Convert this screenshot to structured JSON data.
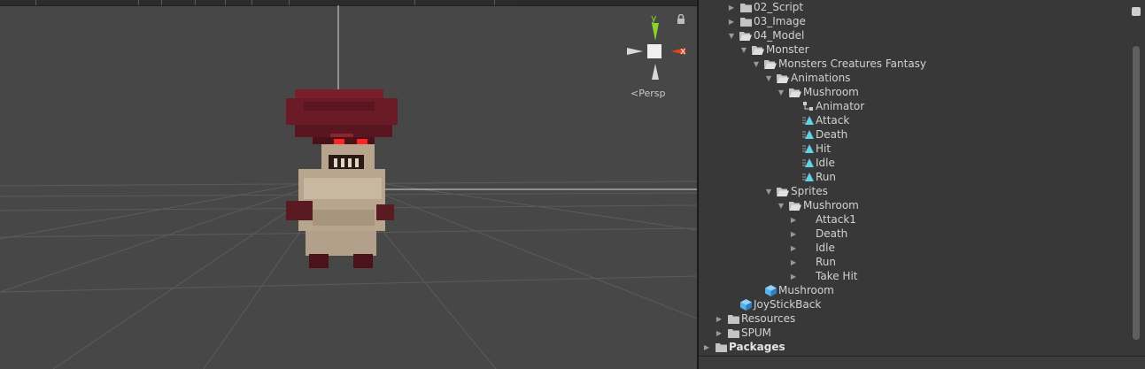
{
  "scene": {
    "persp_label": "Persp",
    "axis_y": "y",
    "axis_x": "x"
  },
  "tree": {
    "items": [
      {
        "label": "02_Script",
        "icon": "folder-icon",
        "arrow": "right"
      },
      {
        "label": "03_Image",
        "icon": "folder-icon",
        "arrow": "right"
      },
      {
        "label": "04_Model",
        "icon": "folder-open-icon",
        "arrow": "down"
      },
      {
        "label": "Monster",
        "icon": "folder-open-icon",
        "arrow": "down"
      },
      {
        "label": "Monsters Creatures Fantasy",
        "icon": "folder-open-icon",
        "arrow": "down"
      },
      {
        "label": "Animations",
        "icon": "folder-open-icon",
        "arrow": "down"
      },
      {
        "label": "Mushroom",
        "icon": "folder-open-icon",
        "arrow": "down"
      },
      {
        "label": "Animator",
        "icon": "animator-controller-icon",
        "arrow": "none"
      },
      {
        "label": "Attack",
        "icon": "animation-clip-icon",
        "arrow": "none"
      },
      {
        "label": "Death",
        "icon": "animation-clip-icon",
        "arrow": "none"
      },
      {
        "label": "Hit",
        "icon": "animation-clip-icon",
        "arrow": "none"
      },
      {
        "label": "Idle",
        "icon": "animation-clip-icon",
        "arrow": "none"
      },
      {
        "label": "Run",
        "icon": "animation-clip-icon",
        "arrow": "none"
      },
      {
        "label": "Sprites",
        "icon": "folder-open-icon",
        "arrow": "down"
      },
      {
        "label": "Mushroom",
        "icon": "folder-open-icon",
        "arrow": "down"
      },
      {
        "label": "Attack1",
        "icon": "sprite-icon",
        "arrow": "right"
      },
      {
        "label": "Death",
        "icon": "sprite-icon",
        "arrow": "right"
      },
      {
        "label": "Idle",
        "icon": "sprite-icon",
        "arrow": "right"
      },
      {
        "label": "Run",
        "icon": "sprite-icon",
        "arrow": "right"
      },
      {
        "label": "Take Hit",
        "icon": "sprite-icon",
        "arrow": "right"
      },
      {
        "label": "Mushroom",
        "icon": "prefab-icon",
        "arrow": "none"
      },
      {
        "label": "JoyStickBack",
        "icon": "prefab-icon",
        "arrow": "none"
      },
      {
        "label": "Resources",
        "icon": "folder-icon",
        "arrow": "right"
      },
      {
        "label": "SPUM",
        "icon": "folder-icon",
        "arrow": "right"
      },
      {
        "label": "Packages",
        "icon": "folder-icon",
        "arrow": "right",
        "bold": true
      }
    ]
  },
  "colors": {
    "scene_bg": "#474747",
    "panel_bg": "#383838",
    "axis_y": "#8bd22d",
    "axis_x": "#e8431f",
    "clip_icon": "#5ed3e6",
    "prefab_icon": "#57b0e8"
  }
}
